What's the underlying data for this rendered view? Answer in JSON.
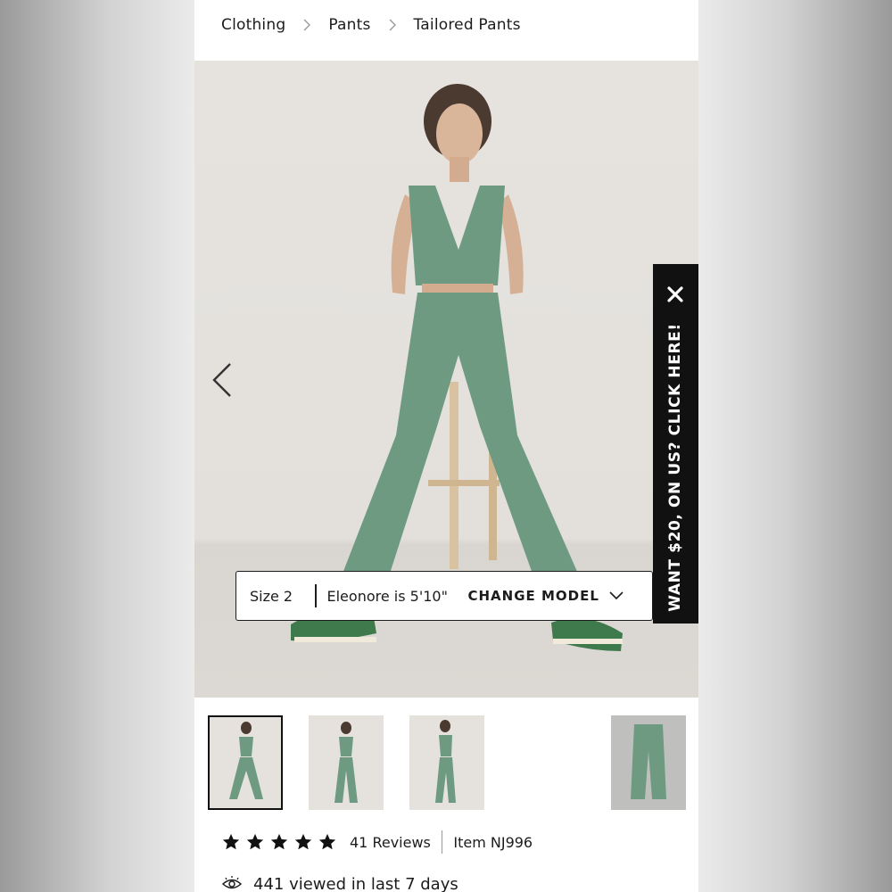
{
  "breadcrumb": {
    "items": [
      "Clothing",
      "Pants",
      "Tailored Pants"
    ]
  },
  "model": {
    "size": "Size 2",
    "description": "Eleonore is 5'10\"",
    "change_label": "CHANGE MODEL"
  },
  "promo": {
    "text": "WANT $20, ON US? CLICK HERE!"
  },
  "product": {
    "rating": 5,
    "reviews_label": "41 Reviews",
    "item_label": "Item NJ996",
    "views_label": "441 viewed in last 7 days"
  },
  "colors": {
    "garment_green": "#6e9a82",
    "sneaker_green": "#3f7a4d",
    "text": "#1c1c1c",
    "promo_bg": "#111111"
  },
  "icons": [
    "chevron-right-icon",
    "chevron-left-icon",
    "close-icon",
    "chevron-down-icon",
    "star-icon",
    "eye-icon"
  ]
}
